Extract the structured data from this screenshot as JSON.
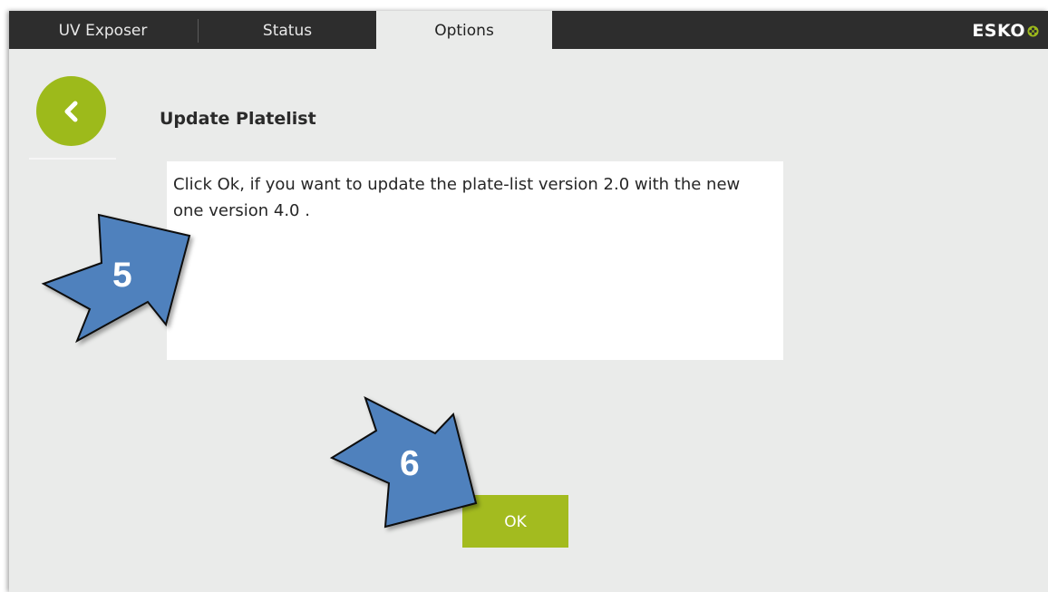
{
  "tabs": [
    {
      "label": "UV Exposer"
    },
    {
      "label": "Status"
    },
    {
      "label": "Options"
    }
  ],
  "active_tab": "Options",
  "brand": {
    "name": "ESKO",
    "mark_color": "#9dba1b"
  },
  "page": {
    "title": "Update Platelist",
    "message": "Click Ok, if you want to update the plate-list version 2.0 with the new one version 4.0 ."
  },
  "buttons": {
    "ok_label": "OK",
    "back_icon": "chevron-left-icon"
  },
  "callouts": [
    {
      "label": "5",
      "target": "message-box"
    },
    {
      "label": "6",
      "target": "ok-button"
    }
  ],
  "colors": {
    "accent": "#a3bb1f",
    "topbar": "#2d2d2d",
    "background": "#eaebea",
    "callout_fill": "#4f81bd"
  }
}
